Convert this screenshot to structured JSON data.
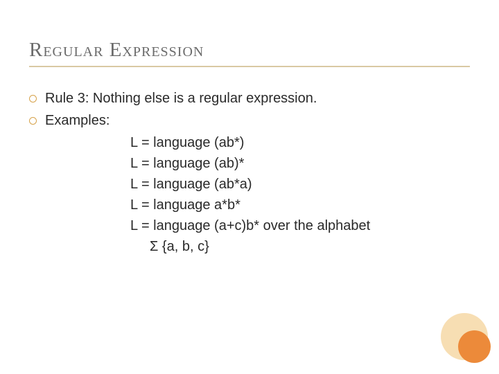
{
  "title": "Regular Expression",
  "bullets": [
    {
      "text": "Rule 3: Nothing else is a regular expression."
    },
    {
      "text": "Examples:"
    }
  ],
  "examples": [
    "L = language (ab*)",
    "L = language (ab)*",
    "L = language (ab*a)",
    "L = language  a*b*",
    "L = language (a+c)b* over the alphabet"
  ],
  "alphabet_line": "Σ {a, b, c}"
}
